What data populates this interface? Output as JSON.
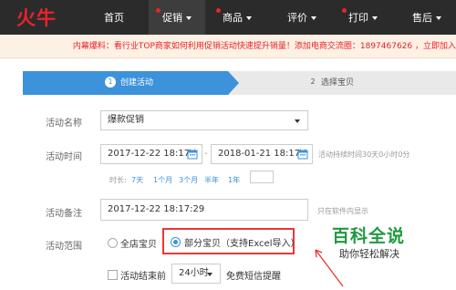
{
  "brand": {
    "logo_text": "火牛"
  },
  "nav": {
    "items": [
      {
        "label": "首页",
        "has_dot": false,
        "has_caret": false,
        "active": false
      },
      {
        "label": "促销",
        "has_dot": true,
        "has_caret": true,
        "active": true
      },
      {
        "label": "商品",
        "has_dot": true,
        "has_caret": true,
        "active": false
      },
      {
        "label": "评价",
        "has_dot": false,
        "has_caret": true,
        "active": false
      },
      {
        "label": "打印",
        "has_dot": true,
        "has_caret": true,
        "active": false
      },
      {
        "label": "售后",
        "has_dot": false,
        "has_caret": true,
        "active": false
      }
    ]
  },
  "notice": {
    "text": "内幕爆料：看行业TOP商家如何利用促销活动快速提升销量！添加电商交流圈：1897467626 ，立即加入"
  },
  "steps": [
    {
      "num": "1",
      "label": "创建活动",
      "active": true
    },
    {
      "num": "2",
      "label": "选择宝贝",
      "active": false
    }
  ],
  "form": {
    "name": {
      "label": "活动名称",
      "value": "爆款促销"
    },
    "time": {
      "label": "活动时间",
      "start": "2017-12-22 18:17",
      "end": "2018-01-21 18:17",
      "hint": "活动持续时间30天0小时0分"
    },
    "duration": {
      "prefix": "时长:",
      "options": [
        "7天",
        "1个月",
        "3个月",
        "半年",
        "1年"
      ]
    },
    "remark": {
      "label": "活动备注",
      "value": "2017-12-22 18:17:29",
      "hint": "只在软件内显示"
    },
    "scope": {
      "label": "活动范围",
      "options": [
        {
          "label": "全店宝贝",
          "selected": false
        },
        {
          "label": "部分宝贝（支持Excel导入）",
          "selected": true
        }
      ]
    },
    "remind": {
      "label": "活动结束前",
      "select_value": "24小时",
      "suffix": "免费短信提醒"
    }
  },
  "watermark": {
    "title": "百科全说",
    "subtitle": "助你轻松解决"
  },
  "colors": {
    "nav_bg": "#2b2b2b",
    "accent_blue": "#3c92db",
    "notice_red": "#e8232a",
    "highlight_red": "#e53935",
    "watermark_green": "#1f9a3e"
  }
}
